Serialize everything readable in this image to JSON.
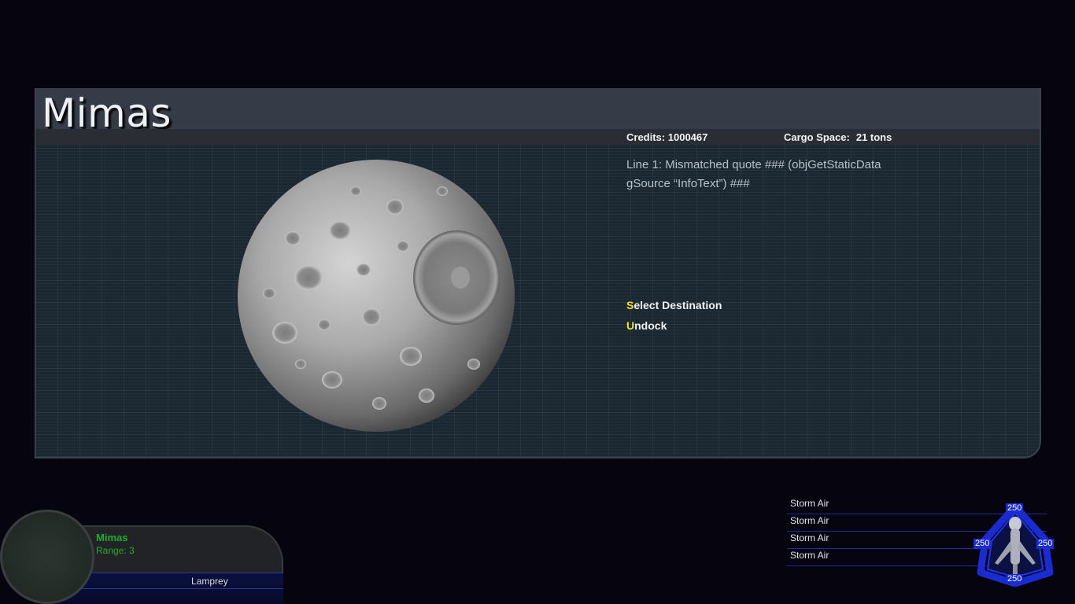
{
  "station": {
    "title": "Mimas",
    "credits_label": "Credits:",
    "credits_value": "1000467",
    "cargo_label": "Cargo Space:",
    "cargo_value": "21 tons",
    "description_line1": "Line 1: Mismatched quote ### (objGetStaticData",
    "description_line2": "gSource “InfoText”) ###",
    "actions": [
      {
        "key": "S",
        "rest": "elect Destination"
      },
      {
        "key": "U",
        "rest": "ndock"
      }
    ]
  },
  "target": {
    "name": "Mimas",
    "range": "Range: 3",
    "ship": "Lamprey"
  },
  "devices": [
    {
      "label": "Storm Air"
    },
    {
      "label": "Storm Air"
    },
    {
      "label": "Storm Air"
    },
    {
      "label": "Storm Air"
    }
  ],
  "shields": {
    "top": "250",
    "left": "250",
    "right": "250",
    "bottom": "250"
  },
  "colors": {
    "target_text": "#1fae2a",
    "hotkey": "#f2e21c",
    "shield_blue": "#1a2bd0"
  }
}
